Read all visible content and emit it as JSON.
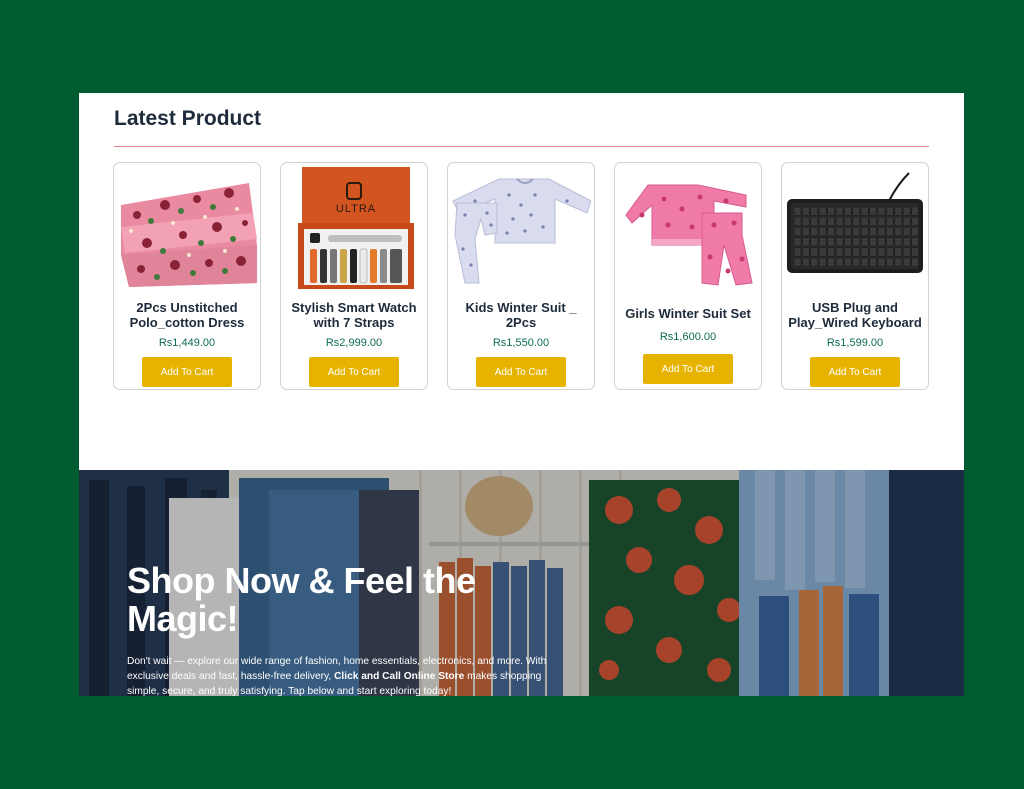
{
  "latest": {
    "title": "Latest Product",
    "products": [
      {
        "name": "2Pcs Unstitched Polo_cotton Dress",
        "price": "Rs1,449.00",
        "button": "Add To Cart",
        "image": "pink-floral-fabric"
      },
      {
        "name": "Stylish Smart Watch with 7 Straps",
        "price": "Rs2,999.00",
        "button": "Add To Cart",
        "image": "ultra-watch-box",
        "brand": "ULTRA"
      },
      {
        "name": "Kids Winter Suit _ 2Pcs",
        "price": "Rs1,550.00",
        "button": "Add To Cart",
        "image": "kids-winter-suit"
      },
      {
        "name": "Girls Winter Suit Set",
        "price": "Rs1,600.00",
        "button": "Add To Cart",
        "image": "girls-winter-suit"
      },
      {
        "name": "USB Plug and Play_Wired Keyboard",
        "price": "Rs1,599.00",
        "button": "Add To Cart",
        "image": "wired-keyboard"
      }
    ]
  },
  "hero": {
    "title": "Shop Now & Feel the Magic!",
    "text_before": "Don't wait — explore our wide range of fashion, home essentials, electronics, and more. With exclusive deals and fast, hassle-free delivery, ",
    "store_name": "Click and Call Online Store",
    "text_after": " makes shopping simple, secure, and truly satisfying. Tap below and start exploring today!"
  },
  "colors": {
    "background": "#005b30",
    "button": "#e6b400",
    "price": "#0e6b57",
    "rule": "#e6828c"
  }
}
